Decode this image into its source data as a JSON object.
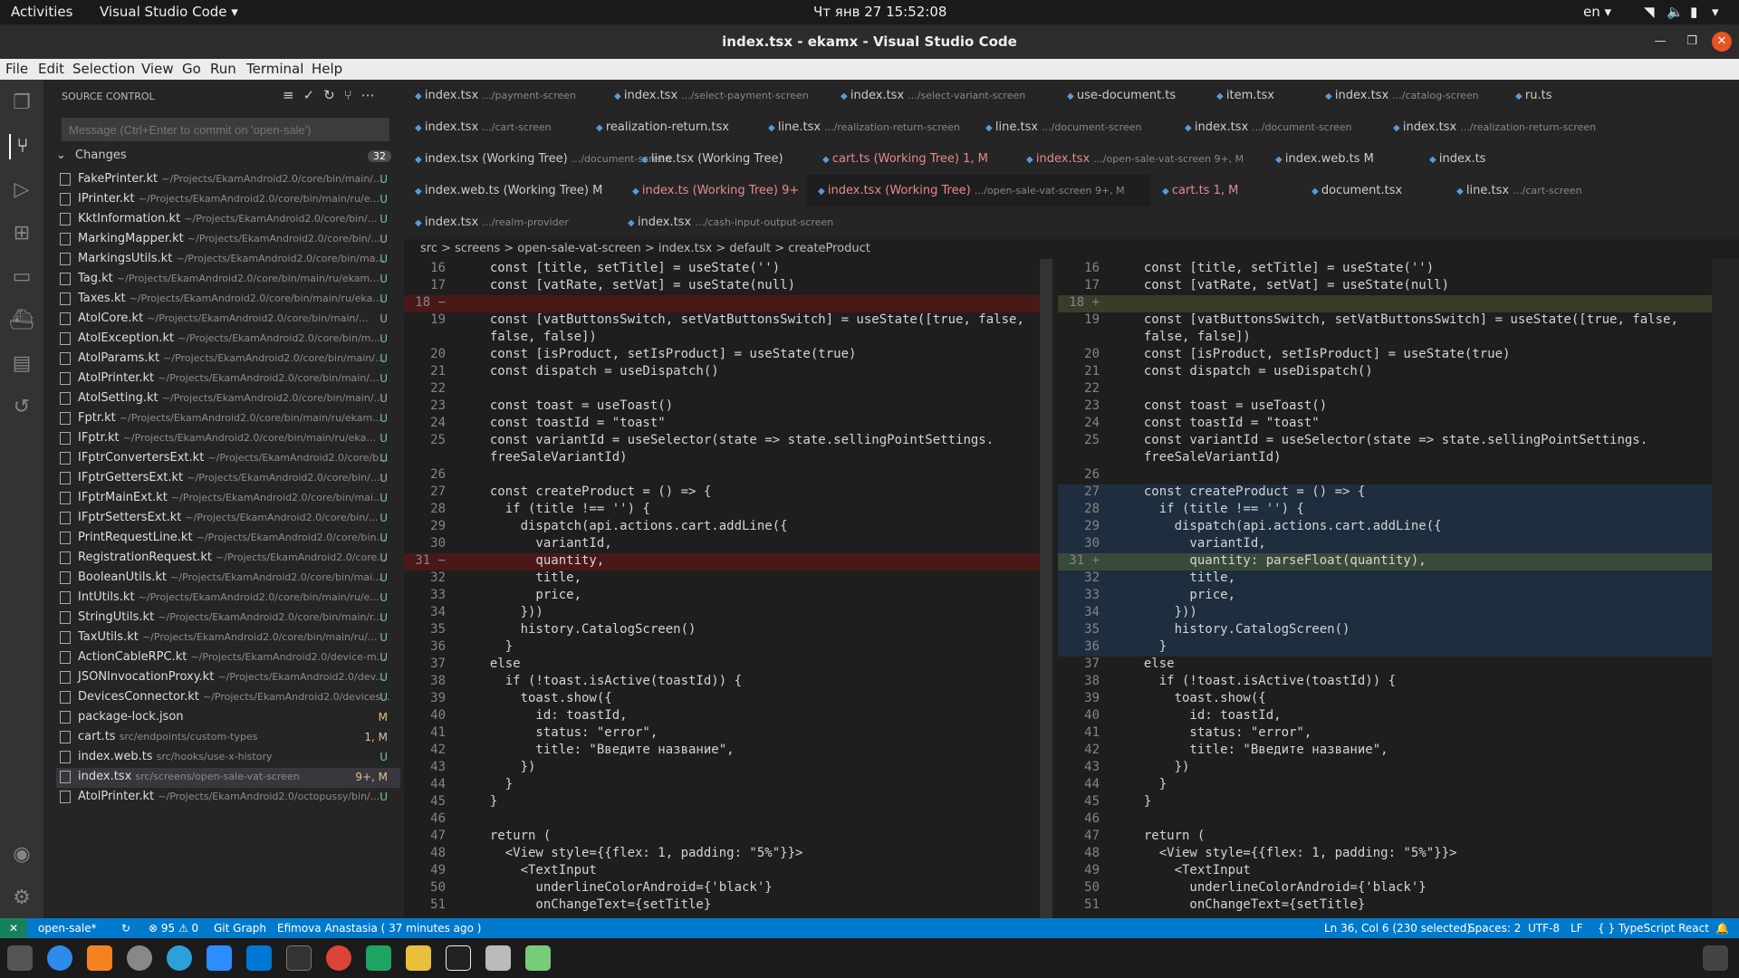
{
  "topbar": {
    "activities": "Activities",
    "app": "Visual Studio Code ▾",
    "clock": "Чт янв 27  15:52:08",
    "lang": "en ▾"
  },
  "title": "index.tsx - ekamx - Visual Studio Code",
  "menu": [
    "File",
    "Edit",
    "Selection",
    "View",
    "Go",
    "Run",
    "Terminal",
    "Help"
  ],
  "sidebar": {
    "header": "SOURCE CONTROL",
    "message_placeholder": "Message (Ctrl+Enter to commit on 'open-sale')",
    "changes_label": "Changes",
    "changes_count": "32",
    "files": [
      {
        "name": "FakePrinter.kt",
        "path": "~/Projects/EkamAndroid2.0/core/bin/main/...",
        "status": "U"
      },
      {
        "name": "IPrinter.kt",
        "path": "~/Projects/EkamAndroid2.0/core/bin/main/ru/e...",
        "status": "U"
      },
      {
        "name": "KktInformation.kt",
        "path": "~/Projects/EkamAndroid2.0/core/bin/...",
        "status": "U"
      },
      {
        "name": "MarkingMapper.kt",
        "path": "~/Projects/EkamAndroid2.0/core/bin/...",
        "status": "U"
      },
      {
        "name": "MarkingsUtils.kt",
        "path": "~/Projects/EkamAndroid2.0/core/bin/ma...",
        "status": "U"
      },
      {
        "name": "Tag.kt",
        "path": "~/Projects/EkamAndroid2.0/core/bin/main/ru/ekam...",
        "status": "U"
      },
      {
        "name": "Taxes.kt",
        "path": "~/Projects/EkamAndroid2.0/core/bin/main/ru/eka...",
        "status": "U"
      },
      {
        "name": "AtolCore.kt",
        "path": "~/Projects/EkamAndroid2.0/core/bin/main/...",
        "status": "U"
      },
      {
        "name": "AtolException.kt",
        "path": "~/Projects/EkamAndroid2.0/core/bin/m...",
        "status": "U"
      },
      {
        "name": "AtolParams.kt",
        "path": "~/Projects/EkamAndroid2.0/core/bin/main/...",
        "status": "U"
      },
      {
        "name": "AtolPrinter.kt",
        "path": "~/Projects/EkamAndroid2.0/core/bin/main/...",
        "status": "U"
      },
      {
        "name": "AtolSetting.kt",
        "path": "~/Projects/EkamAndroid2.0/core/bin/main/...",
        "status": "U"
      },
      {
        "name": "Fptr.kt",
        "path": "~/Projects/EkamAndroid2.0/core/bin/main/ru/ekam...",
        "status": "U"
      },
      {
        "name": "IFptr.kt",
        "path": "~/Projects/EkamAndroid2.0/core/bin/main/ru/eka...",
        "status": "U"
      },
      {
        "name": "IFptrConvertersExt.kt",
        "path": "~/Projects/EkamAndroid2.0/core/b...",
        "status": "U"
      },
      {
        "name": "IFptrGettersExt.kt",
        "path": "~/Projects/EkamAndroid2.0/core/bin/...",
        "status": "U"
      },
      {
        "name": "IFptrMainExt.kt",
        "path": "~/Projects/EkamAndroid2.0/core/bin/mai...",
        "status": "U"
      },
      {
        "name": "IFptrSettersExt.kt",
        "path": "~/Projects/EkamAndroid2.0/core/bin/...",
        "status": "U"
      },
      {
        "name": "PrintRequestLine.kt",
        "path": "~/Projects/EkamAndroid2.0/core/bin...",
        "status": "U"
      },
      {
        "name": "RegistrationRequest.kt",
        "path": "~/Projects/EkamAndroid2.0/core...",
        "status": "U"
      },
      {
        "name": "BooleanUtils.kt",
        "path": "~/Projects/EkamAndroid2.0/core/bin/mai...",
        "status": "U"
      },
      {
        "name": "IntUtils.kt",
        "path": "~/Projects/EkamAndroid2.0/core/bin/main/ru/e...",
        "status": "U"
      },
      {
        "name": "StringUtils.kt",
        "path": "~/Projects/EkamAndroid2.0/core/bin/main/r...",
        "status": "U"
      },
      {
        "name": "TaxUtils.kt",
        "path": "~/Projects/EkamAndroid2.0/core/bin/main/ru/...",
        "status": "U"
      },
      {
        "name": "ActionCableRPC.kt",
        "path": "~/Projects/EkamAndroid2.0/device-m...",
        "status": "U"
      },
      {
        "name": "JSONInvocationProxy.kt",
        "path": "~/Projects/EkamAndroid2.0/dev...",
        "status": "U"
      },
      {
        "name": "DevicesConnector.kt",
        "path": "~/Projects/EkamAndroid2.0/devices...",
        "status": "U"
      },
      {
        "name": "package-lock.json",
        "path": "",
        "status": "M"
      },
      {
        "name": "cart.ts",
        "path": "src/endpoints/custom-types",
        "status": "1, M"
      },
      {
        "name": "index.web.ts",
        "path": "src/hooks/use-x-history",
        "status": "U"
      },
      {
        "name": "index.tsx",
        "path": "src/screens/open-sale-vat-screen",
        "status": "9+, M"
      },
      {
        "name": "AtolPrinter.kt",
        "path": "~/Projects/EkamAndroid2.0/octopussy/bin/...",
        "status": "U"
      }
    ]
  },
  "tab_rows": [
    [
      {
        "name": "index.tsx",
        "path": ".../payment-screen"
      },
      {
        "name": "index.tsx",
        "path": ".../select-payment-screen"
      },
      {
        "name": "index.tsx",
        "path": ".../select-variant-screen"
      },
      {
        "name": "use-document.ts",
        "path": ""
      },
      {
        "name": "item.tsx",
        "path": ""
      },
      {
        "name": "index.tsx",
        "path": ".../catalog-screen"
      },
      {
        "name": "ru.ts",
        "path": ""
      }
    ],
    [
      {
        "name": "index.tsx",
        "path": ".../cart-screen"
      },
      {
        "name": "realization-return.tsx",
        "path": ""
      },
      {
        "name": "line.tsx",
        "path": ".../realization-return-screen"
      },
      {
        "name": "line.tsx",
        "path": ".../document-screen"
      },
      {
        "name": "index.tsx",
        "path": ".../document-screen"
      },
      {
        "name": "index.tsx",
        "path": ".../realization-return-screen"
      }
    ],
    [
      {
        "name": "index.tsx (Working Tree)",
        "path": ".../document-screen"
      },
      {
        "name": "line.tsx (Working Tree)",
        "path": ""
      },
      {
        "name": "cart.ts (Working Tree)  1, M",
        "path": ""
      },
      {
        "name": "index.tsx",
        "path": ".../open-sale-vat-screen  9+, M"
      },
      {
        "name": "index.web.ts  M",
        "path": ""
      },
      {
        "name": "index.ts",
        "path": ""
      }
    ],
    [
      {
        "name": "index.web.ts (Working Tree)  M",
        "path": ""
      },
      {
        "name": "index.ts (Working Tree)  9+",
        "path": ""
      },
      {
        "name": "index.tsx (Working Tree)",
        "path": ".../open-sale-vat-screen  9+, M"
      },
      {
        "name": "cart.ts  1, M",
        "path": ""
      },
      {
        "name": "document.tsx",
        "path": ""
      },
      {
        "name": "line.tsx",
        "path": ".../cart-screen"
      }
    ],
    [
      {
        "name": "index.tsx",
        "path": ".../realm-provider"
      },
      {
        "name": "index.tsx",
        "path": ".../cash-input-output-screen"
      }
    ]
  ],
  "breadcrumb": "src  >  screens  >  open-sale-vat-screen  >  index.tsx  >  default  >  createProduct",
  "left_lines": [
    {
      "n": "16",
      "c": "  const [title, setTitle] = useState('')"
    },
    {
      "n": "17",
      "c": "  const [vatRate, setVat] = useState(null)"
    },
    {
      "n": "18 −",
      "c": ""
    },
    {
      "n": "19",
      "c": "  const [vatButtonsSwitch, setVatButtonsSwitch] = useState([true, false,"
    },
    {
      "n": "",
      "c": "  false, false])"
    },
    {
      "n": "20",
      "c": "  const [isProduct, setIsProduct] = useState(true)"
    },
    {
      "n": "21",
      "c": "  const dispatch = useDispatch()"
    },
    {
      "n": "22",
      "c": ""
    },
    {
      "n": "23",
      "c": "  const toast = useToast()"
    },
    {
      "n": "24",
      "c": "  const toastId = \"toast\""
    },
    {
      "n": "25",
      "c": "  const variantId = useSelector(state => state.sellingPointSettings."
    },
    {
      "n": "",
      "c": "  freeSaleVariantId)"
    },
    {
      "n": "26",
      "c": ""
    },
    {
      "n": "27",
      "c": "  const createProduct = () => {"
    },
    {
      "n": "28",
      "c": "    if (title !== '') {"
    },
    {
      "n": "29",
      "c": "      dispatch(api.actions.cart.addLine({"
    },
    {
      "n": "30",
      "c": "        variantId,"
    },
    {
      "n": "31 −",
      "c": "        quantity,"
    },
    {
      "n": "32",
      "c": "        title,"
    },
    {
      "n": "33",
      "c": "        price,"
    },
    {
      "n": "34",
      "c": "      }))"
    },
    {
      "n": "35",
      "c": "      history.CatalogScreen()"
    },
    {
      "n": "36",
      "c": "    }"
    },
    {
      "n": "37",
      "c": "  else"
    },
    {
      "n": "38",
      "c": "    if (!toast.isActive(toastId)) {"
    },
    {
      "n": "39",
      "c": "      toast.show({"
    },
    {
      "n": "40",
      "c": "        id: toastId,"
    },
    {
      "n": "41",
      "c": "        status: \"error\","
    },
    {
      "n": "42",
      "c": "        title: \"Введите название\","
    },
    {
      "n": "43",
      "c": "      })"
    },
    {
      "n": "44",
      "c": "    }"
    },
    {
      "n": "45",
      "c": "  }"
    },
    {
      "n": "46",
      "c": ""
    },
    {
      "n": "47",
      "c": "  return ("
    },
    {
      "n": "48",
      "c": "    <View style={{flex: 1, padding: \"5%\"}}>"
    },
    {
      "n": "49",
      "c": "      <TextInput"
    },
    {
      "n": "50",
      "c": "        underlineColorAndroid={'black'}"
    },
    {
      "n": "51",
      "c": "        onChangeText={setTitle}"
    }
  ],
  "right_lines": [
    {
      "n": "16",
      "c": "  const [title, setTitle] = useState('')"
    },
    {
      "n": "17",
      "c": "  const [vatRate, setVat] = useState(null)"
    },
    {
      "n": "18 +",
      "c": ""
    },
    {
      "n": "19",
      "c": "  const [vatButtonsSwitch, setVatButtonsSwitch] = useState([true, false,"
    },
    {
      "n": "",
      "c": "  false, false])"
    },
    {
      "n": "20",
      "c": "  const [isProduct, setIsProduct] = useState(true)"
    },
    {
      "n": "21",
      "c": "  const dispatch = useDispatch()"
    },
    {
      "n": "22",
      "c": ""
    },
    {
      "n": "23",
      "c": "  const toast = useToast()"
    },
    {
      "n": "24",
      "c": "  const toastId = \"toast\""
    },
    {
      "n": "25",
      "c": "  const variantId = useSelector(state => state.sellingPointSettings."
    },
    {
      "n": "",
      "c": "  freeSaleVariantId)"
    },
    {
      "n": "26",
      "c": ""
    },
    {
      "n": "27",
      "c": "  const createProduct = () => {"
    },
    {
      "n": "28",
      "c": "    if (title !== '') {"
    },
    {
      "n": "29",
      "c": "      dispatch(api.actions.cart.addLine({"
    },
    {
      "n": "30",
      "c": "        variantId,"
    },
    {
      "n": "31 +",
      "c": "        quantity: parseFloat(quantity),"
    },
    {
      "n": "32",
      "c": "        title,"
    },
    {
      "n": "33",
      "c": "        price,"
    },
    {
      "n": "34",
      "c": "      }))"
    },
    {
      "n": "35",
      "c": "      history.CatalogScreen()"
    },
    {
      "n": "36",
      "c": "    }"
    },
    {
      "n": "37",
      "c": "  else"
    },
    {
      "n": "38",
      "c": "    if (!toast.isActive(toastId)) {"
    },
    {
      "n": "39",
      "c": "      toast.show({"
    },
    {
      "n": "40",
      "c": "        id: toastId,"
    },
    {
      "n": "41",
      "c": "        status: \"error\","
    },
    {
      "n": "42",
      "c": "        title: \"Введите название\","
    },
    {
      "n": "43",
      "c": "      })"
    },
    {
      "n": "44",
      "c": "    }"
    },
    {
      "n": "45",
      "c": "  }"
    },
    {
      "n": "46",
      "c": ""
    },
    {
      "n": "47",
      "c": "  return ("
    },
    {
      "n": "48",
      "c": "    <View style={{flex: 1, padding: \"5%\"}}>"
    },
    {
      "n": "49",
      "c": "      <TextInput"
    },
    {
      "n": "50",
      "c": "        underlineColorAndroid={'black'}"
    },
    {
      "n": "51",
      "c": "        onChangeText={setTitle}"
    }
  ],
  "statusbar": {
    "branch": "open-sale*",
    "problems": "⊗ 95 ⚠ 0",
    "gitgraph": "Git Graph",
    "blame": "Efimova Anastasia ( 37 minutes ago )",
    "position": "Ln 36, Col 6 (230 selected)",
    "spaces": "Spaces: 2",
    "encoding": "UTF-8",
    "eol": "LF",
    "language": "{ } TypeScript React"
  },
  "colors": {
    "accent": "#007acc",
    "removed": "#4b1818",
    "added": "#373d29",
    "selection": "#264f78"
  },
  "icons": [
    "explorer-icon",
    "source-control-icon",
    "run-debug-icon",
    "extensions-icon",
    "remote-icon",
    "docker-icon",
    "folder-icon",
    "history-icon",
    "account-icon",
    "gear-icon"
  ]
}
